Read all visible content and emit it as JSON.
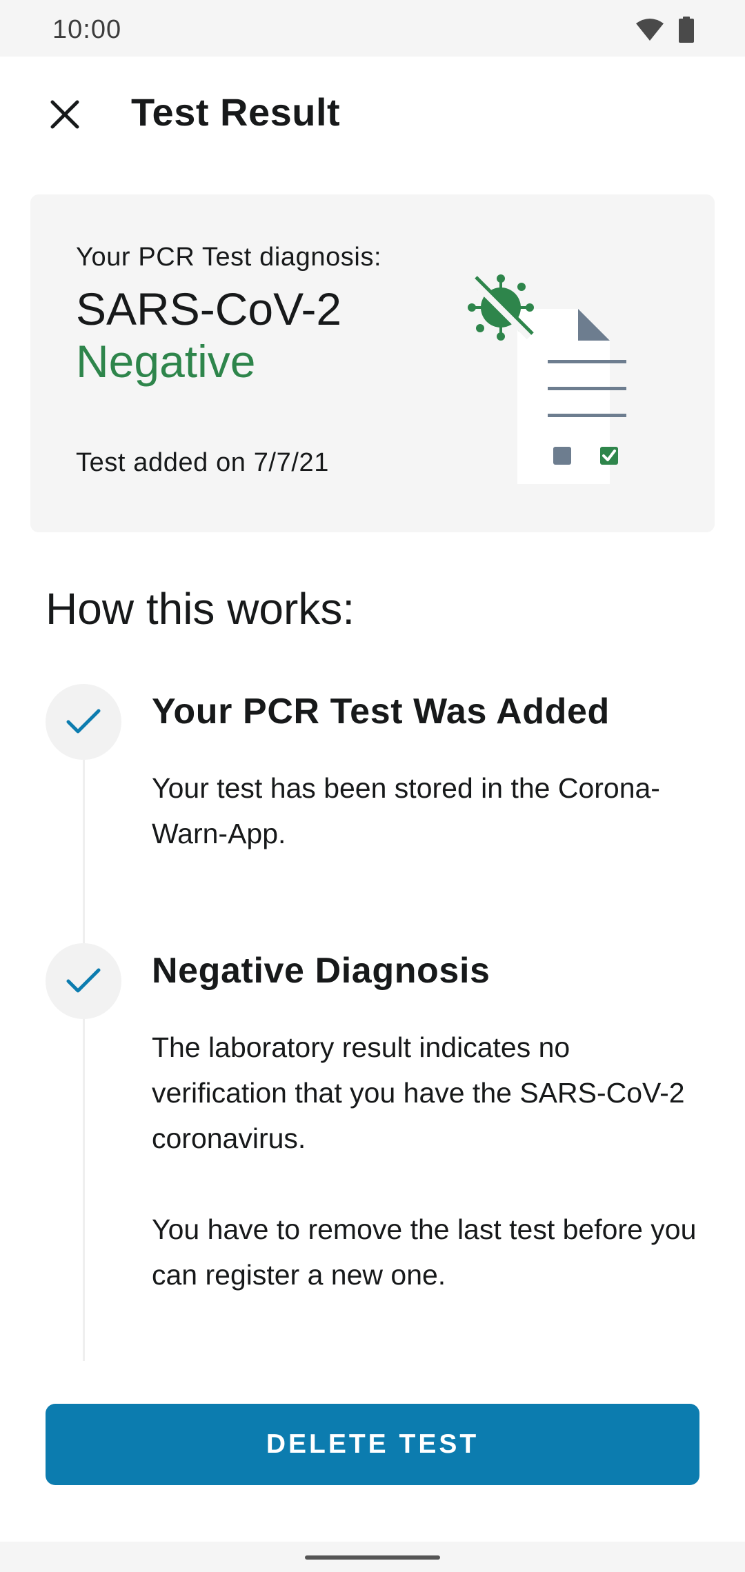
{
  "status_bar": {
    "time": "10:00",
    "icons": [
      "wifi-icon",
      "battery-icon"
    ]
  },
  "app_bar": {
    "close_icon": "close-icon",
    "title": "Test Result"
  },
  "result_card": {
    "subtitle": "Your PCR Test diagnosis:",
    "virus_name": "SARS-CoV-2",
    "result": "Negative",
    "result_color": "#2e854b",
    "date_text": "Test added on 7/7/21",
    "illustration_icon": "negative-test-document-icon"
  },
  "how_it_works": {
    "heading": "How this works:",
    "steps": [
      {
        "icon": "checkmark-icon",
        "title": "Your PCR Test Was Added",
        "body": [
          "Your test has been stored in the Corona-Warn-App."
        ]
      },
      {
        "icon": "checkmark-icon",
        "title": "Negative Diagnosis",
        "body": [
          "The laboratory result indicates no verification that you have the SARS-CoV-2 coronavirus.",
          "You have to remove the last test before you can register a new one."
        ]
      }
    ]
  },
  "actions": {
    "delete_label": "DELETE TEST"
  },
  "colors": {
    "accent": "#0c7caf",
    "negative_green": "#2e854b",
    "card_background": "#f5f5f5"
  }
}
